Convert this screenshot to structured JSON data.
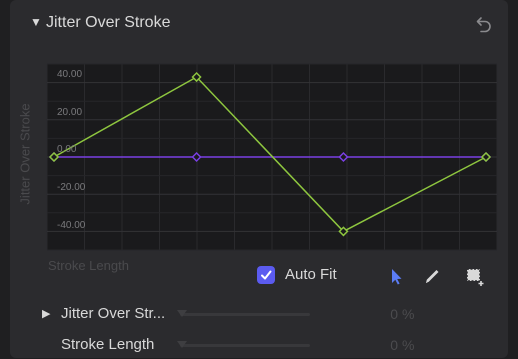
{
  "header": {
    "disclosure_glyph": "▼",
    "title": "Jitter Over Stroke",
    "reset_icon": "undo-arrow-icon"
  },
  "chart_data": {
    "type": "line",
    "ylabel": "Jitter Over Stroke",
    "xlabel": "Stroke Length",
    "ylim": [
      -50,
      50
    ],
    "xlim": [
      0,
      1
    ],
    "yticks": [
      "40.00",
      "20.00",
      "0.00",
      "-20.00",
      "-40.00"
    ],
    "ytick_values": [
      40,
      20,
      0,
      -20,
      -40
    ],
    "grid": true,
    "series": [
      {
        "points": [
          [
            0.0,
            0.0
          ],
          [
            0.33,
            43.0
          ],
          [
            0.67,
            -40.0
          ],
          [
            1.0,
            0.0
          ]
        ],
        "color": "#8ec63f"
      },
      {
        "points": [
          [
            0.0,
            0.0
          ],
          [
            0.33,
            0.0
          ],
          [
            0.67,
            0.0
          ],
          [
            1.0,
            0.0
          ]
        ],
        "color": "#7b3fe4"
      }
    ]
  },
  "controls": {
    "autofit_label": "Auto Fit",
    "autofit_checked": true,
    "tools": [
      "select-arrow-icon",
      "pen-icon",
      "add-region-icon"
    ],
    "accent_color": "#5b5bf0"
  },
  "params": [
    {
      "label": "Jitter Over Str...",
      "value": "0",
      "unit": "%",
      "has_disclosure": true,
      "disclosure_glyph": "▶"
    },
    {
      "label": "Stroke Length",
      "value": "0",
      "unit": "%",
      "has_disclosure": false
    }
  ]
}
